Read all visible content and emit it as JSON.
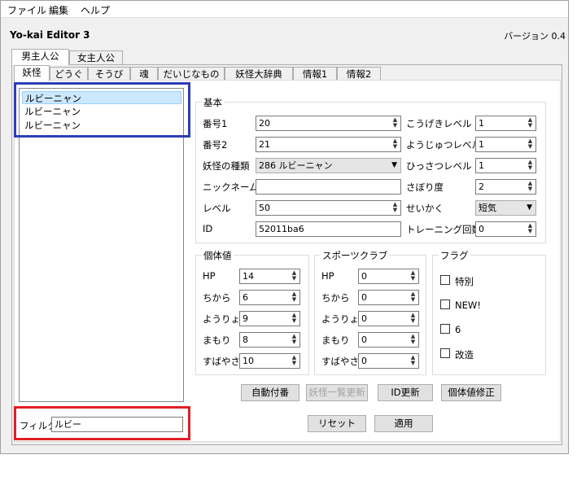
{
  "menu": {
    "items": [
      "ファイル",
      "編集",
      "ヘルプ"
    ]
  },
  "app": {
    "title": "Yo-kai Editor 3",
    "version": "バージョン 0.4"
  },
  "outer_tabs": [
    "男主人公",
    "女主人公"
  ],
  "inner_tabs": [
    "妖怪",
    "どうぐ",
    "そうび",
    "魂",
    "だいじなもの",
    "妖怪大辞典",
    "情報1",
    "情報2"
  ],
  "list": {
    "items": [
      "ルビーニャン",
      "ルビーニャン",
      "ルビーニャン"
    ],
    "selected_index": 0
  },
  "filter": {
    "label": "フィルタ",
    "value": "ルビー"
  },
  "basic": {
    "title": "基本",
    "number1_label": "番号1",
    "number1_value": "20",
    "number2_label": "番号2",
    "number2_value": "21",
    "kind_label": "妖怪の種類",
    "kind_value": "286 ルビーニャン",
    "nickname_label": "ニックネーム",
    "nickname_value": "",
    "level_label": "レベル",
    "level_value": "50",
    "id_label": "ID",
    "id_value": "52011ba6",
    "attack_label": "こうげきレベル",
    "attack_value": "1",
    "technique_label": "ようじゅつレベル",
    "technique_value": "1",
    "soultimate_label": "ひっさつレベル",
    "soultimate_value": "1",
    "savagery_label": "さぼり度",
    "savagery_value": "2",
    "personality_label": "せいかく",
    "personality_value": "短気",
    "training_label": "トレーニング回数",
    "training_value": "0"
  },
  "iv": {
    "title": "個体値",
    "stats": [
      {
        "label": "HP",
        "value": "14"
      },
      {
        "label": "ちから",
        "value": "6"
      },
      {
        "label": "ようりょく",
        "value": "9"
      },
      {
        "label": "まもり",
        "value": "8"
      },
      {
        "label": "すばやさ",
        "value": "10"
      }
    ]
  },
  "sports": {
    "title": "スポーツクラブ",
    "stats": [
      {
        "label": "HP",
        "value": "0"
      },
      {
        "label": "ちから",
        "value": "0"
      },
      {
        "label": "ようりょく",
        "value": "0"
      },
      {
        "label": "まもり",
        "value": "0"
      },
      {
        "label": "すばやさ",
        "value": "0"
      }
    ]
  },
  "flags": {
    "title": "フラグ",
    "items": [
      {
        "label": "特別",
        "checked": false
      },
      {
        "label": "NEW!",
        "checked": false
      },
      {
        "label": "6",
        "checked": false
      },
      {
        "label": "改造",
        "checked": false
      }
    ]
  },
  "buttons": {
    "auto_number": "自動付番",
    "refresh_list": "妖怪一覧更新",
    "update_id": "ID更新",
    "fix_iv": "個体値修正",
    "reset": "リセット",
    "apply": "適用"
  }
}
